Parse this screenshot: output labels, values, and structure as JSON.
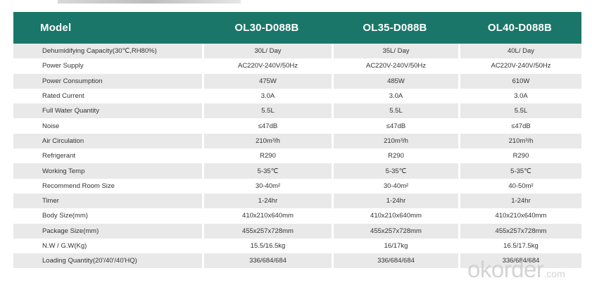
{
  "header": {
    "label": "Model",
    "models": [
      "OL30-D088B",
      "OL35-D088B",
      "OL40-D088B"
    ]
  },
  "rows": [
    {
      "label": "Dehumidifying Capacity(30℃,RH80%)",
      "values": [
        "30L/ Day",
        "35L/ Day",
        "40L/ Day"
      ]
    },
    {
      "label": "Power Supply",
      "values": [
        "AC220V-240V/50Hz",
        "AC220V-240V/50Hz",
        "AC220V-240V/50Hz"
      ]
    },
    {
      "label": "Power Consumption",
      "values": [
        "475W",
        "485W",
        "610W"
      ]
    },
    {
      "label": "Rated Current",
      "values": [
        "3.0A",
        "3.0A",
        "3.0A"
      ]
    },
    {
      "label": "Full Water Quantity",
      "values": [
        "5.5L",
        "5.5L",
        "5.5L"
      ]
    },
    {
      "label": "Noise",
      "values": [
        "≤47dB",
        "≤47dB",
        "≤47dB"
      ]
    },
    {
      "label": "Air Circulation",
      "values": [
        "210m³/h",
        "210m³/h",
        "210m³/h"
      ]
    },
    {
      "label": "Refrigerant",
      "values": [
        "R290",
        "R290",
        "R290"
      ]
    },
    {
      "label": "Working Temp",
      "values": [
        "5-35℃",
        "5-35℃",
        "5-35℃"
      ]
    },
    {
      "label": "Recommend Room Size",
      "values": [
        "30-40m²",
        "30-40m²",
        "40-50m²"
      ]
    },
    {
      "label": "Timer",
      "values": [
        "1-24hr",
        "1-24hr",
        "1-24hr"
      ]
    },
    {
      "label": "Body Size(mm)",
      "values": [
        "410x210x640mm",
        "410x210x640mm",
        "410x210x640mm"
      ]
    },
    {
      "label": "Package Size(mm)",
      "values": [
        "455x257x728mm",
        "455x257x728mm",
        "455x257x728mm"
      ]
    },
    {
      "label": "N.W / G.W(Kg)",
      "values": [
        "15.5/16.5kg",
        "16/17kg",
        "16.5/17.5kg"
      ]
    },
    {
      "label": "Loading Quantity(20'/40'/40'HQ)",
      "values": [
        "336/684/684",
        "336/684/684",
        "336/684/684"
      ]
    }
  ],
  "watermark": {
    "main": "okorder",
    "suffix": ".com"
  },
  "colors": {
    "header_bg": "#1a7668",
    "row_alt": "#e9e9e9"
  }
}
